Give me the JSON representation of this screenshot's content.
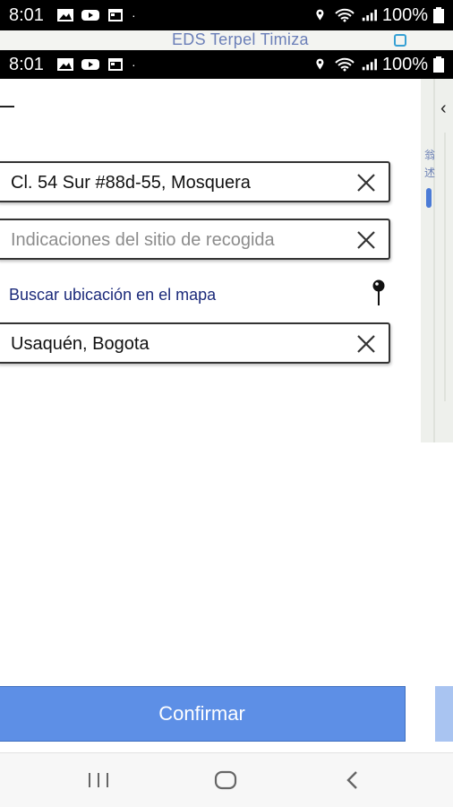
{
  "status_bar": {
    "time": "8:01",
    "battery": "100%",
    "icons_left": [
      "image-icon",
      "youtube-icon",
      "calendar-icon",
      "dot-icon"
    ],
    "icons_right": [
      "location-icon",
      "wifi-icon",
      "signal-icon",
      "battery-icon"
    ]
  },
  "map_top": {
    "label": "EDS Terpel Timiza"
  },
  "form": {
    "origin_value": "Cl. 54 Sur #88d-55, Mosquera",
    "pickup_notes_placeholder": "Indicaciones del sitio de recogida",
    "map_search_link": "Buscar ubicación en el mapa",
    "destination_value": "Usaquén, Bogota"
  },
  "buttons": {
    "confirm_label": "Confirmar"
  },
  "map_right": {
    "text_1": "翁",
    "text_2": "述"
  },
  "colors": {
    "confirm_bg": "#5d8fe6",
    "link": "#1b2a7a"
  },
  "nav_bar": {
    "items": [
      "recent-apps-icon",
      "home-icon",
      "back-icon"
    ]
  }
}
